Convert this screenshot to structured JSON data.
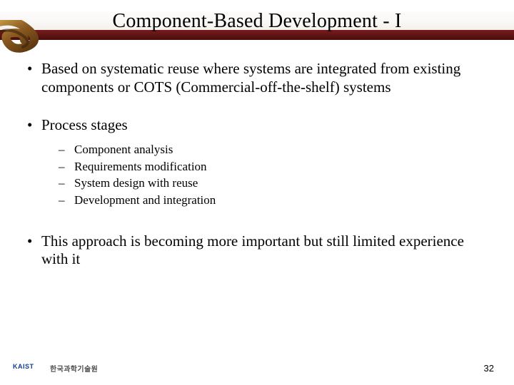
{
  "title": "Component-Based Development - I",
  "bullets": {
    "b1": "Based on systematic reuse where systems are integrated from existing components or COTS (Commercial-off-the-shelf) systems",
    "b2": "Process stages",
    "sub": {
      "s1": "Component analysis",
      "s2": "Requirements modification",
      "s3": "System design with reuse",
      "s4": "Development and integration"
    },
    "b3": "This approach is becoming more important but still limited experience with it"
  },
  "footer": {
    "org_kor": "한국과학기술원",
    "page": "32"
  }
}
